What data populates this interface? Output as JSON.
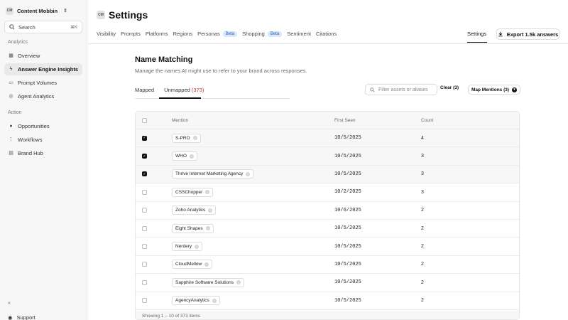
{
  "workspace": {
    "badge": "CM",
    "name": "Content Mobbin"
  },
  "search": {
    "label": "Search",
    "shortcut": "⌘K"
  },
  "sidebar": {
    "section_analytics": "Analytics",
    "section_action": "Action",
    "items": [
      {
        "label": "Overview",
        "icon": "grid-icon"
      },
      {
        "label": "Answer Engine Insights",
        "icon": "bolt-icon"
      },
      {
        "label": "Prompt Volumes",
        "icon": "chat-icon"
      },
      {
        "label": "Agent Analytics",
        "icon": "agent-icon"
      },
      {
        "label": "Opportunities",
        "icon": "bulb-icon"
      },
      {
        "label": "Workflows",
        "icon": "workflow-icon"
      },
      {
        "label": "Brand Hub",
        "icon": "hub-icon"
      }
    ],
    "support": "Support",
    "collapse": "«"
  },
  "page": {
    "badge": "CM",
    "title": "Settings"
  },
  "tabs": {
    "visibility": "Visibility",
    "prompts": "Prompts",
    "platforms": "Platforms",
    "regions": "Regions",
    "personas": "Personas",
    "shopping": "Shopping",
    "sentiment": "Sentiment",
    "citations": "Citations",
    "beta": "Beta",
    "settings": "Settings"
  },
  "export_label": "Export 1.5k answers",
  "section": {
    "title": "Name Matching",
    "description": "Manage the names AI might use to refer to your brand across responses."
  },
  "subtabs": {
    "mapped": "Mapped",
    "unmapped": "Unmapped",
    "unmapped_count": "(373)"
  },
  "filter": {
    "placeholder": "Filter assets or aliases"
  },
  "clear_label": "Clear (3)",
  "map_label": "Map Mentions (3)",
  "table": {
    "headers": {
      "mention": "Mention",
      "first_seen": "First Seen",
      "count": "Count"
    },
    "rows": [
      {
        "mention": "S-PRO",
        "first_seen": "10/5/2025",
        "count": "4",
        "selected": true
      },
      {
        "mention": "WHO",
        "first_seen": "10/5/2025",
        "count": "3",
        "selected": true
      },
      {
        "mention": "Thrive Internet Marketing Agency",
        "first_seen": "10/5/2025",
        "count": "3",
        "selected": true
      },
      {
        "mention": "CSSChopper",
        "first_seen": "10/2/2025",
        "count": "3",
        "selected": false
      },
      {
        "mention": "Zoho Analytics",
        "first_seen": "10/6/2025",
        "count": "2",
        "selected": false
      },
      {
        "mention": "Eight Shapes",
        "first_seen": "10/5/2025",
        "count": "2",
        "selected": false
      },
      {
        "mention": "Nerdery",
        "first_seen": "10/5/2025",
        "count": "2",
        "selected": false
      },
      {
        "mention": "CloudMellow",
        "first_seen": "10/5/2025",
        "count": "2",
        "selected": false
      },
      {
        "mention": "Sapphire Software Solutions",
        "first_seen": "10/5/2025",
        "count": "2",
        "selected": false
      },
      {
        "mention": "AgencyAnalytics",
        "first_seen": "10/5/2025",
        "count": "2",
        "selected": false
      }
    ],
    "footer": "Showing 1 – 10 of 373 items"
  }
}
